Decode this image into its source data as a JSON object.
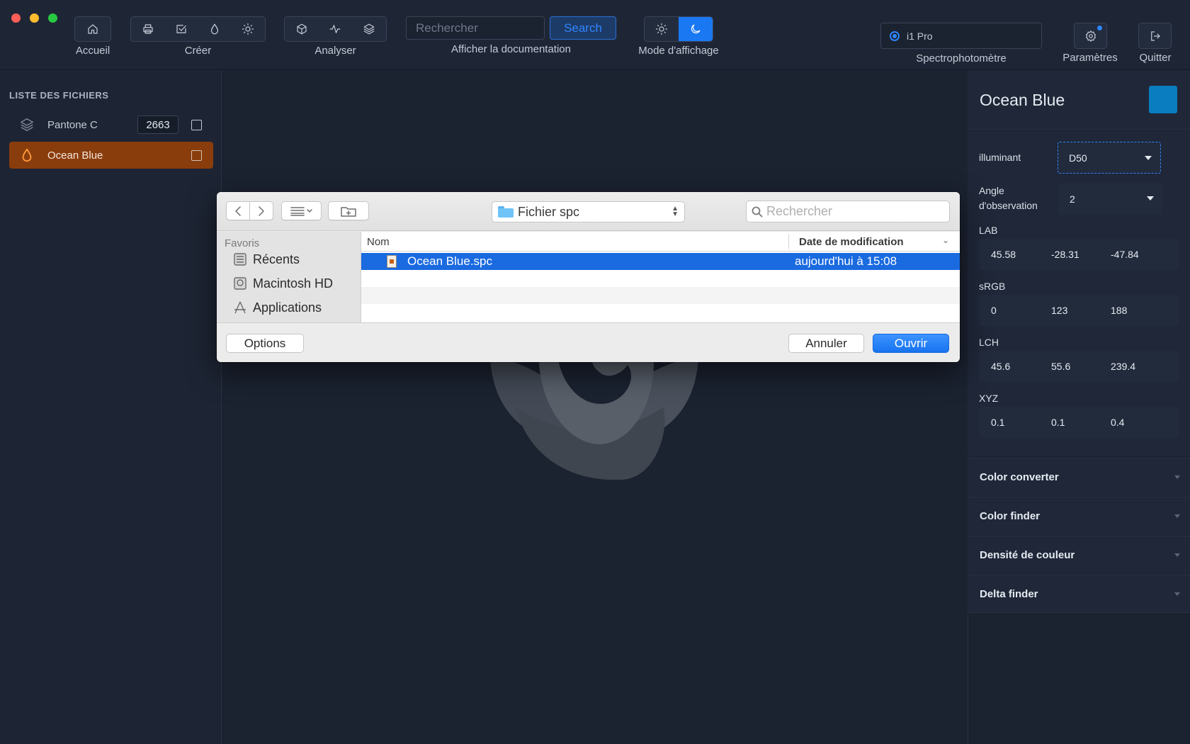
{
  "toolbar": {
    "groups": {
      "home_label": "Accueil",
      "create_label": "Créer",
      "analyze_label": "Analyser",
      "docs_label": "Afficher la documentation",
      "display_mode_label": "Mode d'affichage",
      "spectro_label": "Spectrophotomètre",
      "settings_label": "Paramètres",
      "quit_label": "Quitter"
    },
    "search": {
      "placeholder": "Rechercher",
      "button_label": "Search"
    },
    "device": {
      "selected": "i1 Pro"
    },
    "accent_color": "#1a78f2"
  },
  "sidebar": {
    "title": "LISTE DES FICHIERS",
    "items": [
      {
        "name": "Pantone C",
        "count": "2663",
        "icon": "layers-icon",
        "active": false
      },
      {
        "name": "Ocean Blue",
        "icon": "drop-icon",
        "active": true
      }
    ]
  },
  "panel": {
    "title": "Ocean Blue",
    "swatch_color": "#0a7cc0",
    "illuminant_label": "illuminant",
    "illuminant_value": "D50",
    "angle_label_1": "Angle",
    "angle_label_2": "d'observation",
    "angle_value": "2",
    "lab": {
      "label": "LAB",
      "values": [
        "45.58",
        "-28.31",
        "-47.84"
      ]
    },
    "srgb": {
      "label": "sRGB",
      "values": [
        "0",
        "123",
        "188"
      ]
    },
    "lch": {
      "label": "LCH",
      "values": [
        "45.6",
        "55.6",
        "239.4"
      ]
    },
    "xyz": {
      "label": "XYZ",
      "values": [
        "0.1",
        "0.1",
        "0.4"
      ]
    },
    "accordion": [
      "Color converter",
      "Color finder",
      "Densité de couleur",
      "Delta finder"
    ]
  },
  "dialog": {
    "path": "Fichier spc",
    "search_placeholder": "Rechercher",
    "sidebar_header": "Favoris",
    "favorites": [
      "Récents",
      "Macintosh HD",
      "Applications"
    ],
    "columns": {
      "name": "Nom",
      "date": "Date de modification"
    },
    "files": [
      {
        "name": "Ocean Blue.spc",
        "date": "aujourd'hui à 15:08"
      }
    ],
    "options_label": "Options",
    "cancel_label": "Annuler",
    "open_label": "Ouvrir"
  }
}
